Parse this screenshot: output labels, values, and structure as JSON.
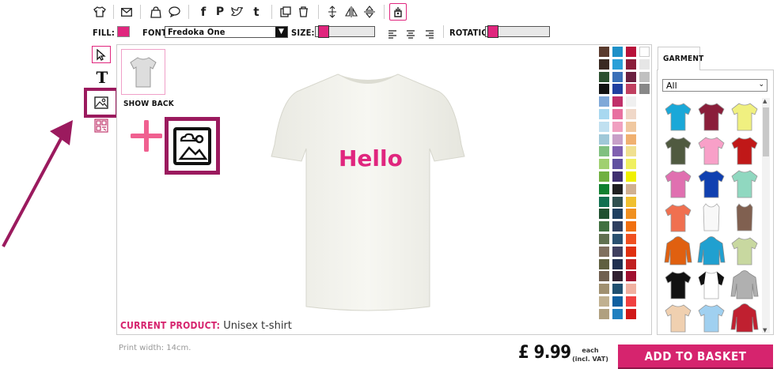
{
  "toolbar": {
    "fill_label": "FILL:",
    "font_label": "FONT:",
    "font_value": "Fredoka One",
    "size_label": "SIZE:",
    "rotation_label": "ROTATION:",
    "fill_color": "#e0267e"
  },
  "left_tools": [
    "pointer-icon",
    "text-icon",
    "image-icon",
    "qr-icon"
  ],
  "show_back": "SHOW BACK",
  "canvas": {
    "text": "Hello",
    "text_color": "#e0267e",
    "current_product_label": "CURRENT PRODUCT:",
    "current_product_value": "Unisex t-shirt"
  },
  "print_width": "Print width: 14cm.",
  "price": {
    "amount": "£ 9.99",
    "each": "each",
    "vat": "(incl. VAT)"
  },
  "add_to_basket": "ADD TO BASKET",
  "garment_panel": {
    "tab": "GARMENT",
    "filter_value": "All"
  },
  "colors": {
    "accent": "#d6246e",
    "highlight_border": "#9b1a5e"
  }
}
